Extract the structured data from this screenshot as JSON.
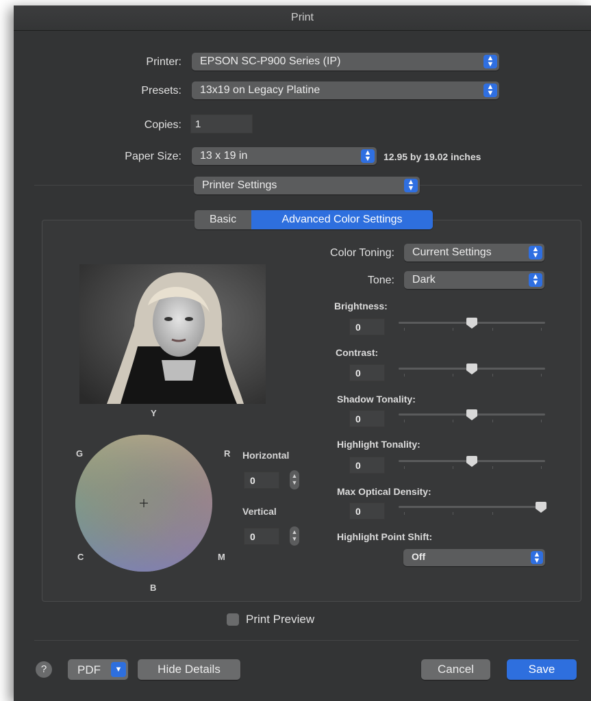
{
  "window": {
    "title": "Print"
  },
  "printer": {
    "label": "Printer:",
    "value": "EPSON SC-P900 Series (IP)"
  },
  "presets": {
    "label": "Presets:",
    "value": "13x19 on Legacy Platine"
  },
  "copies": {
    "label": "Copies:",
    "value": "1"
  },
  "paper_size": {
    "label": "Paper Size:",
    "value": "13 x 19 in",
    "dimensions": "12.95 by 19.02 inches"
  },
  "section": {
    "value": "Printer Settings"
  },
  "tabs": [
    {
      "label": "Basic",
      "selected": false
    },
    {
      "label": "Advanced Color Settings",
      "selected": true
    }
  ],
  "color_toning": {
    "label": "Color Toning:",
    "value": "Current Settings"
  },
  "tone": {
    "label": "Tone:",
    "value": "Dark"
  },
  "sliders": [
    {
      "label": "Brightness:",
      "value": "0",
      "position": 0.5
    },
    {
      "label": "Contrast:",
      "value": "0",
      "position": 0.5
    },
    {
      "label": "Shadow Tonality:",
      "value": "0",
      "position": 0.5
    },
    {
      "label": "Highlight Tonality:",
      "value": "0",
      "position": 0.5
    },
    {
      "label": "Max Optical Density:",
      "value": "0",
      "position": 1.0
    }
  ],
  "highlight_point_shift": {
    "label": "Highlight Point Shift:",
    "value": "Off"
  },
  "color_wheel": {
    "labels": {
      "y": "Y",
      "g": "G",
      "r": "R",
      "c": "C",
      "m": "M",
      "b": "B"
    },
    "horizontal": {
      "label": "Horizontal",
      "value": "0"
    },
    "vertical": {
      "label": "Vertical",
      "value": "0"
    }
  },
  "print_preview": {
    "label": "Print Preview",
    "checked": false
  },
  "footer": {
    "help": "?",
    "pdf": "PDF",
    "hide_details": "Hide Details",
    "cancel": "Cancel",
    "save": "Save"
  },
  "colors": {
    "accent": "#2e6fde",
    "background": "#333435"
  }
}
